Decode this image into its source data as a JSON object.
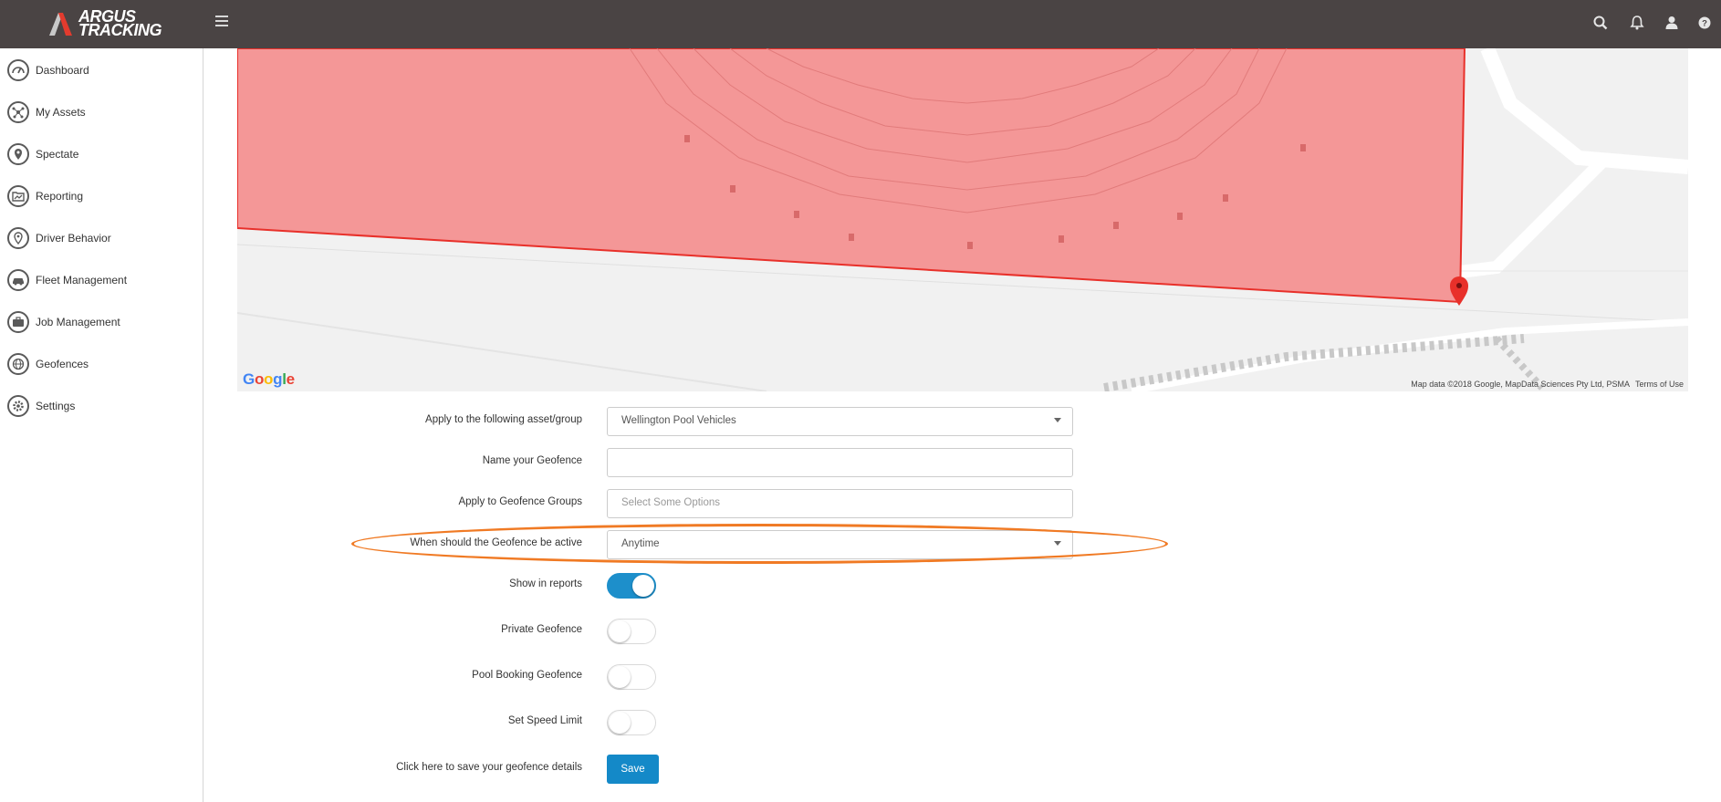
{
  "brand": {
    "line1": "ARGUS",
    "line2": "TRACKING"
  },
  "topbar": {
    "icons": [
      "search-icon",
      "bell-icon",
      "user-icon",
      "help-icon"
    ]
  },
  "sidebar": {
    "items": [
      {
        "label": "Dashboard",
        "icon": "gauge-icon"
      },
      {
        "label": "My Assets",
        "icon": "network-icon"
      },
      {
        "label": "Spectate",
        "icon": "map-pin-icon"
      },
      {
        "label": "Reporting",
        "icon": "folder-chart-icon"
      },
      {
        "label": "Driver Behavior",
        "icon": "pin-outline-icon"
      },
      {
        "label": "Fleet Management",
        "icon": "car-icon"
      },
      {
        "label": "Job Management",
        "icon": "briefcase-icon"
      },
      {
        "label": "Geofences",
        "icon": "globe-icon"
      },
      {
        "label": "Settings",
        "icon": "gear-icon"
      }
    ]
  },
  "map": {
    "google": "Google",
    "attribution": "Map data ©2018 Google, MapData Sciences Pty Ltd, PSMA",
    "terms": "Terms of Use",
    "geofence_fill": "#f48a8a",
    "geofence_stroke": "#e8302a"
  },
  "form": {
    "asset_label": "Apply to the following asset/group",
    "asset_value": "Wellington Pool Vehicles",
    "name_label": "Name your Geofence",
    "name_value": "",
    "groups_label": "Apply to Geofence Groups",
    "groups_placeholder": "Select Some Options",
    "active_label": "When should the Geofence be active",
    "active_value": "Anytime",
    "show_reports_label": "Show in reports",
    "show_reports_on": true,
    "private_label": "Private Geofence",
    "private_on": false,
    "pool_label": "Pool Booking Geofence",
    "pool_on": false,
    "speed_label": "Set Speed Limit",
    "speed_on": false,
    "save_hint": "Click here to save your geofence details",
    "save_label": "Save"
  },
  "colors": {
    "topbar": "#4a4444",
    "accent": "#1489c8",
    "highlight": "#f07a24"
  }
}
